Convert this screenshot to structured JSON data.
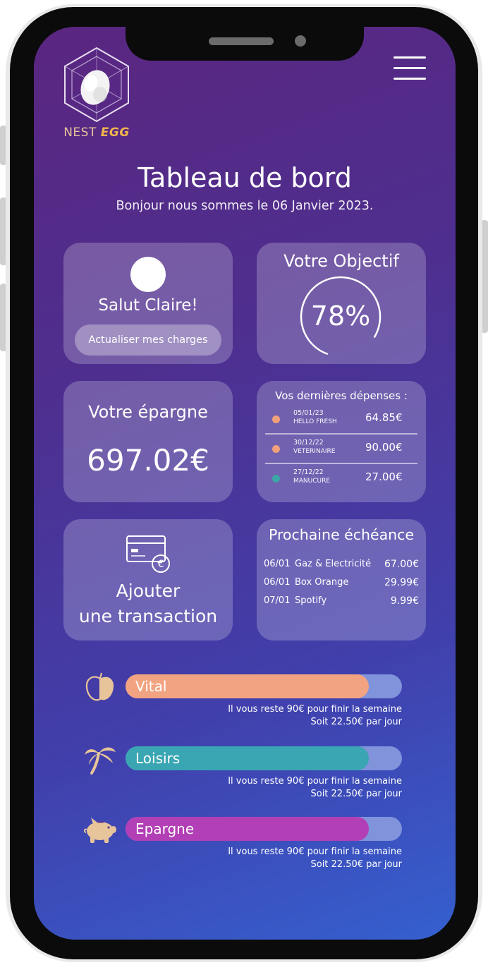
{
  "app": {
    "logo_word1": "NEST",
    "logo_word2": "EGG"
  },
  "header": {
    "title": "Tableau de bord",
    "subtitle": "Bonjour nous sommes le 06 Janvier 2023."
  },
  "profile_card": {
    "greeting": "Salut Claire!",
    "refresh_label": "Actualiser mes charges"
  },
  "goal_card": {
    "heading": "Votre Objectif",
    "percent_label": "78%",
    "progress": 0.78
  },
  "savings_card": {
    "heading": "Votre épargne",
    "amount": "697.02€"
  },
  "expenses_card": {
    "heading": "Vos dernières dépenses :",
    "items": [
      {
        "date": "05/01/23",
        "name": "HELLO FRESH",
        "amount": "64.85€",
        "color": "#f0a07a"
      },
      {
        "date": "30/12/22",
        "name": "VETERINAIRE",
        "amount": "90.00€",
        "color": "#f0a07a"
      },
      {
        "date": "27/12/22",
        "name": "MANUCURE",
        "amount": "27.00€",
        "color": "#3aa6a6"
      }
    ]
  },
  "add_card": {
    "line1": "Ajouter",
    "line2": "une transaction"
  },
  "due_card": {
    "heading": "Prochaine échéance",
    "items": [
      {
        "date": "06/01",
        "name": "Gaz & Electricité",
        "amount": "67.00€"
      },
      {
        "date": "06/01",
        "name": "Box Orange",
        "amount": "29.99€"
      },
      {
        "date": "07/01",
        "name": "Spotify",
        "amount": "9.99€"
      }
    ]
  },
  "budgets": [
    {
      "label": "Vital",
      "icon": "apple-icon",
      "fill": 0.88,
      "color": "#f2a381",
      "note1": "Il vous reste 90€ pour finir la semaine",
      "note2": "Soit 22.50€ par jour"
    },
    {
      "label": "Loisirs",
      "icon": "palm-tree-icon",
      "fill": 0.88,
      "color": "#3aa6b3",
      "note1": "Il vous reste 90€ pour finir la semaine",
      "note2": "Soit 22.50€ par jour"
    },
    {
      "label": "Epargne",
      "icon": "piggy-bank-icon",
      "fill": 0.88,
      "color": "#b23fb5",
      "note1": "Il vous reste 90€ pour finir la semaine",
      "note2": "Soit 22.50€ par jour"
    }
  ],
  "colors": {
    "accent_icon": "#e8c49a",
    "track": "#8193da"
  }
}
